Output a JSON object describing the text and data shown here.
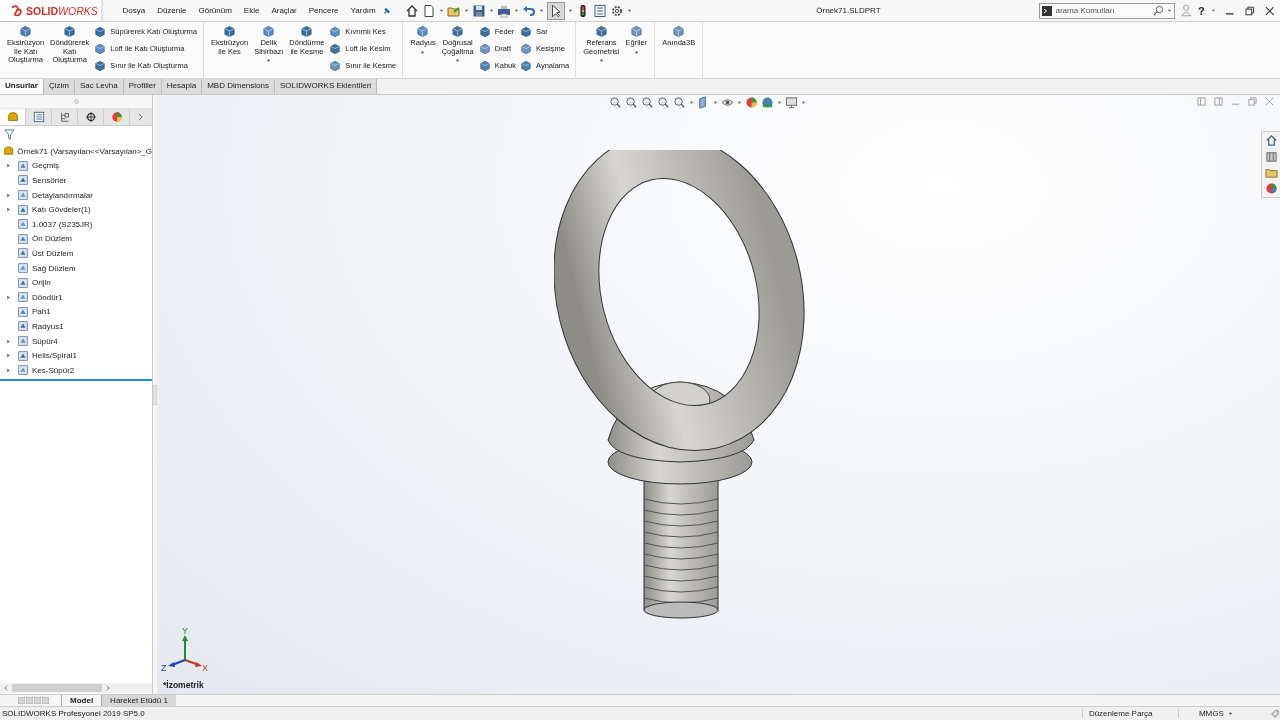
{
  "app": {
    "logo": "**SOLID**WORKS",
    "menu": [
      "Dosya",
      "Düzenle",
      "Görünüm",
      "Ekle",
      "Araçlar",
      "Pencere",
      "Yardım"
    ],
    "document_title": "Örnek71.SLDPRT",
    "search": {
      "placeholder": "arama Komutları"
    },
    "help": "?"
  },
  "ribbon": {
    "groups": [
      {
        "items": [
          {
            "kind": "large",
            "label": "Ekstrüzyon\nİle Katı\nOluşturma",
            "dropdown": false
          },
          {
            "kind": "large",
            "label": "Döndürerek\nKatı\nOluşturma",
            "dropdown": false
          },
          {
            "kind": "stack",
            "items": [
              "Süpürerek Katı Oluşturma",
              "Loft ile Katı Oluşturma",
              "Sınır ile Katı Oluşturma"
            ]
          }
        ]
      },
      {
        "items": [
          {
            "kind": "large",
            "label": "Ekstrüzyon\nile Kes",
            "dropdown": false
          },
          {
            "kind": "large",
            "label": "Delik\nSihirbazı",
            "dropdown": true
          },
          {
            "kind": "large",
            "label": "Döndürme\nile Kesme",
            "dropdown": false
          },
          {
            "kind": "stack",
            "items": [
              "Kıvrımlı Kes",
              "Loft ile Kesim",
              "Sınır ile Kesme"
            ]
          }
        ]
      },
      {
        "items": [
          {
            "kind": "large",
            "label": "Radyus",
            "dropdown": true
          },
          {
            "kind": "large",
            "label": "Doğrusal\nÇoğaltma",
            "dropdown": true
          },
          {
            "kind": "stack",
            "items": [
              "Feder",
              "Draft",
              "Kabuk"
            ]
          },
          {
            "kind": "stack",
            "items": [
              "Sar",
              "Kesişme",
              "Aynalama"
            ]
          }
        ]
      },
      {
        "items": [
          {
            "kind": "large",
            "label": "Referans\nGeometrisi",
            "dropdown": true
          },
          {
            "kind": "large",
            "label": "Eğriler",
            "dropdown": true
          }
        ]
      },
      {
        "items": [
          {
            "kind": "large",
            "label": "Anında3B",
            "dropdown": false
          }
        ]
      }
    ]
  },
  "tabs": [
    {
      "label": "Unsurlar",
      "selected": true
    },
    {
      "label": "Çizim",
      "selected": false
    },
    {
      "label": "Sac Levha",
      "selected": false
    },
    {
      "label": "Profiller",
      "selected": false
    },
    {
      "label": "Hesapla",
      "selected": false
    },
    {
      "label": "MBD Dimensions",
      "selected": false
    },
    {
      "label": "SOLIDWORKS Eklentileri",
      "selected": false
    }
  ],
  "panel_tabs": [
    {
      "selected": true
    },
    {
      "selected": false
    },
    {
      "selected": false
    },
    {
      "selected": false
    },
    {
      "selected": false
    }
  ],
  "tree": {
    "label": "Örnek71  (Varsayılan<<Varsayılan>_G",
    "children": [
      {
        "label": "Geçmiş",
        "expandable": true
      },
      {
        "label": "Sensörler",
        "expandable": false
      },
      {
        "label": "Detaylandırmalar",
        "expandable": true
      },
      {
        "label": "Katı Gövdeler(1)",
        "expandable": true
      },
      {
        "label": "1.0037 (S235JR)",
        "expandable": false
      },
      {
        "label": "Ön Düzlem",
        "expandable": false
      },
      {
        "label": "Üst Düzlem",
        "expandable": false
      },
      {
        "label": "Sağ Düzlem",
        "expandable": false
      },
      {
        "label": "Orijin",
        "expandable": false
      },
      {
        "label": "Döndür1",
        "expandable": true
      },
      {
        "label": "Pah1",
        "expandable": false
      },
      {
        "label": "Radyus1",
        "expandable": false
      },
      {
        "label": "Süpür4",
        "expandable": true
      },
      {
        "label": "Helis/Spiral1",
        "expandable": true
      },
      {
        "label": "Kes-Süpür2",
        "expandable": true
      }
    ]
  },
  "viewport": {
    "view_label": "*İzometrik",
    "triad": {
      "x": "X",
      "y": "Y",
      "z": "Z"
    }
  },
  "bottom_tabs": [
    {
      "label": "Model",
      "selected": true
    },
    {
      "label": "Hareket Etüdü 1",
      "selected": false
    }
  ],
  "status_bar": {
    "product": "SOLIDWORKS Profesyonel 2019 SP5.0",
    "mode": "Düzenleme Parça",
    "units": "MMGS"
  }
}
